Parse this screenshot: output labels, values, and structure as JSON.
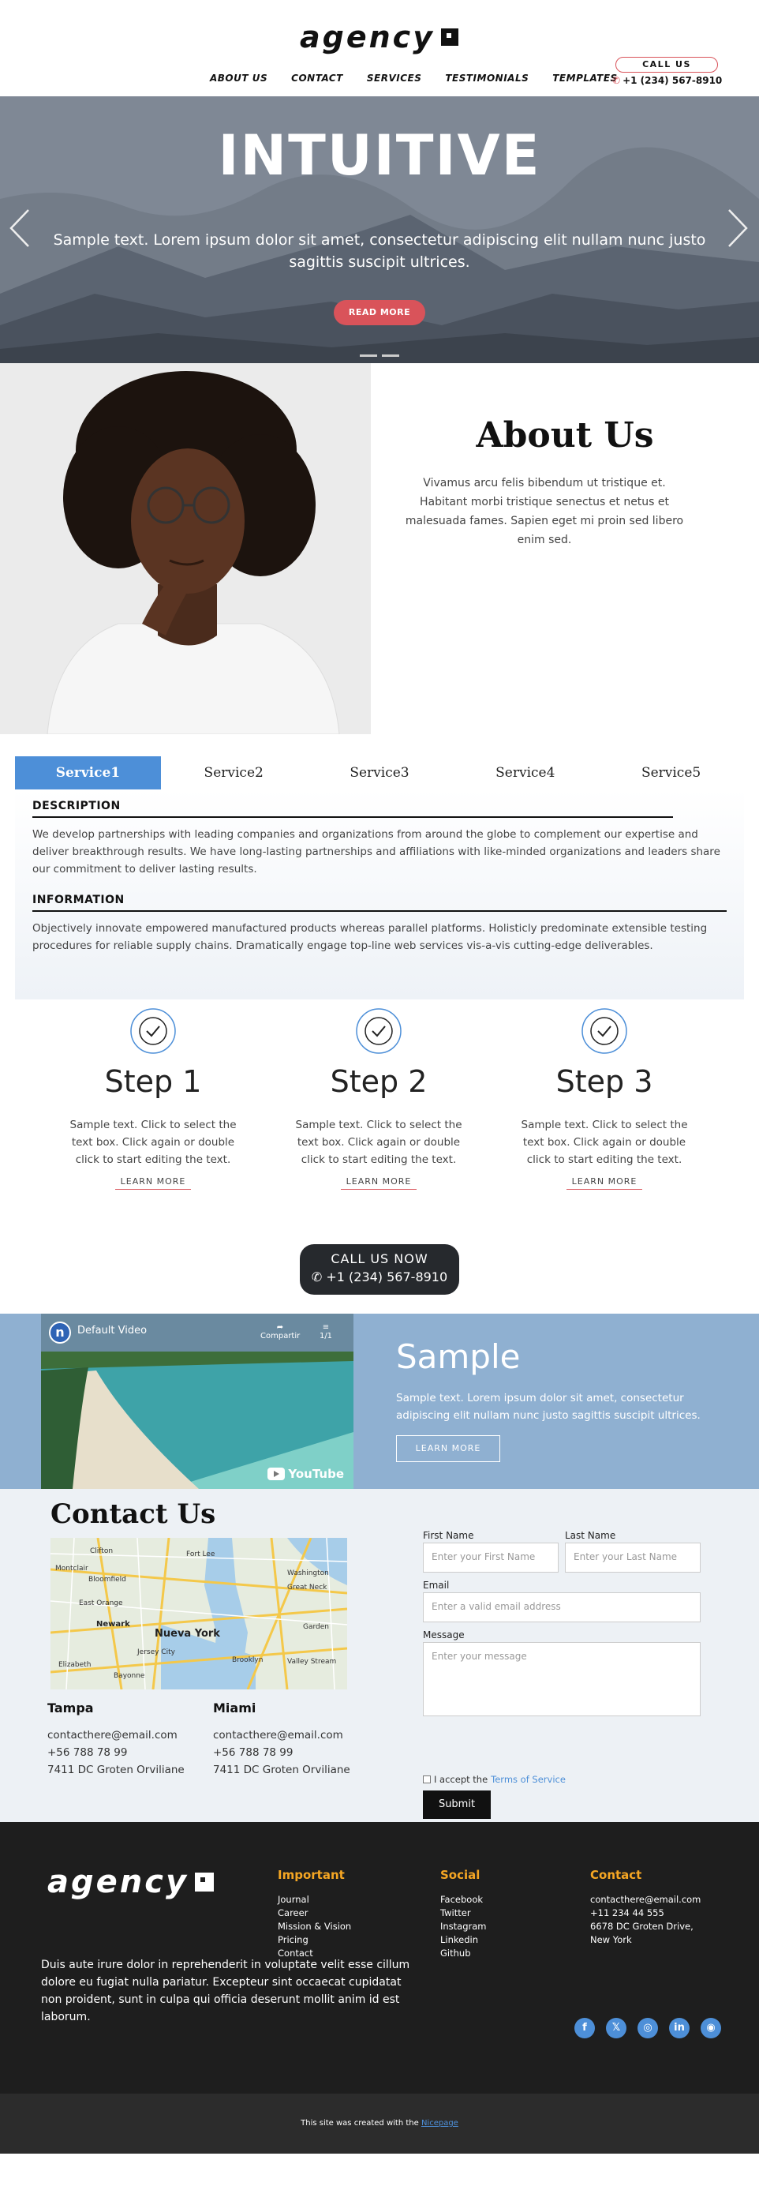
{
  "header": {
    "logo_text": "agency",
    "nav": [
      "ABOUT US",
      "CONTACT",
      "SERVICES",
      "TESTIMONIALS",
      "TEMPLATES"
    ],
    "call_button": "CALL US",
    "phone": "+1 (234) 567-8910"
  },
  "hero": {
    "title": "INTUITIVE",
    "text": "Sample text. Lorem ipsum dolor sit amet, consectetur adipiscing elit nullam nunc justo sagittis suscipit ultrices.",
    "button": "READ MORE"
  },
  "about": {
    "title": "About Us",
    "text": "Vivamus arcu felis bibendum ut tristique et. Habitant morbi tristique senectus et netus et malesuada fames. Sapien eget mi proin sed libero enim sed."
  },
  "tabs": {
    "items": [
      "Service1",
      "Service2",
      "Service3",
      "Service4",
      "Service5"
    ],
    "active": 0,
    "description_title": "DESCRIPTION",
    "description_text": "We develop partnerships with leading companies and organizations from around the globe to complement our expertise and deliver breakthrough results. We have long-lasting partnerships and affiliations with like-minded organizations and leaders share our commitment to deliver lasting results.",
    "information_title": "INFORMATION",
    "information_text": "Objectively innovate empowered manufactured products whereas parallel platforms. Holisticly predominate extensible testing procedures for reliable supply chains. Dramatically engage top-line web services vis-a-vis cutting-edge deliverables."
  },
  "steps": [
    {
      "title": "Step 1",
      "text": "Sample text. Click to select the text box. Click again or double click to start editing the text.",
      "link": "LEARN MORE"
    },
    {
      "title": "Step 2",
      "text": "Sample text. Click to select the text box. Click again or double click to start editing the text.",
      "link": "LEARN MORE"
    },
    {
      "title": "Step 3",
      "text": "Sample text. Click to select the text box. Click again or double click to start editing the text.",
      "link": "LEARN MORE"
    }
  ],
  "call_now": {
    "label": "CALL US NOW",
    "phone": "+1 (234) 567-8910"
  },
  "video": {
    "title": "Default Video",
    "share": "Compartir",
    "playlist": "1/1",
    "brand": "YouTube"
  },
  "sample": {
    "title": "Sample",
    "text": "Sample text. Lorem ipsum dolor sit amet, consectetur adipiscing elit nullam nunc justo sagittis suscipit ultrices.",
    "button": "LEARN MORE"
  },
  "contact": {
    "title": "Contact Us",
    "map_label": "Nueva York",
    "map_places": [
      "Clifton",
      "Fort Lee",
      "Montclair",
      "Bloomfield",
      "Washington",
      "East Orange",
      "Great Neck",
      "Newark",
      "Garden",
      "Jersey City",
      "Brooklyn",
      "Elizabeth",
      "Valley Stream",
      "Bayonne"
    ],
    "cities": [
      {
        "name": "Tampa",
        "email": "contacthere@email.com",
        "phone": "+56 788 78 99",
        "address": "7411 DC Groten Orviliane"
      },
      {
        "name": "Miami",
        "email": "contacthere@email.com",
        "phone": "+56 788 78 99",
        "address": "7411 DC Groten Orviliane"
      }
    ],
    "form": {
      "first_label": "First Name",
      "first_placeholder": "Enter your First Name",
      "last_label": "Last Name",
      "last_placeholder": "Enter your Last Name",
      "email_label": "Email",
      "email_placeholder": "Enter a valid email address",
      "message_label": "Message",
      "message_placeholder": "Enter your message",
      "accept_text": "I accept the",
      "terms_link": "Terms of Service",
      "submit": "Submit"
    }
  },
  "footer": {
    "logo_text": "agency",
    "important_title": "Important",
    "important_links": [
      "Journal",
      "Career",
      "Mission & Vision",
      "Pricing",
      "Contact"
    ],
    "social_title": "Social",
    "social_links": [
      "Facebook",
      "Twitter",
      "Instagram",
      "Linkedin",
      "Github"
    ],
    "contact_title": "Contact",
    "contact_lines": [
      "contacthere@email.com",
      "+11 234 44 555",
      "6678 DC Groten Drive,",
      "New York"
    ],
    "description": "Duis aute irure dolor in reprehenderit in voluptate velit esse cillum dolore eu fugiat nulla pariatur. Excepteur sint occaecat cupidatat non proident, sunt in culpa qui officia deserunt mollit anim id est laborum.",
    "social_icons": [
      "facebook-icon",
      "twitter-x-icon",
      "instagram-icon",
      "linkedin-icon",
      "github-icon"
    ],
    "bottom_text": "This site was created with the",
    "bottom_link": "Nicepage"
  },
  "colors": {
    "accent_red": "#d9535a",
    "accent_blue": "#4d8fd8",
    "footer_heading": "#f5a623",
    "dark": "#1e1e1e"
  }
}
